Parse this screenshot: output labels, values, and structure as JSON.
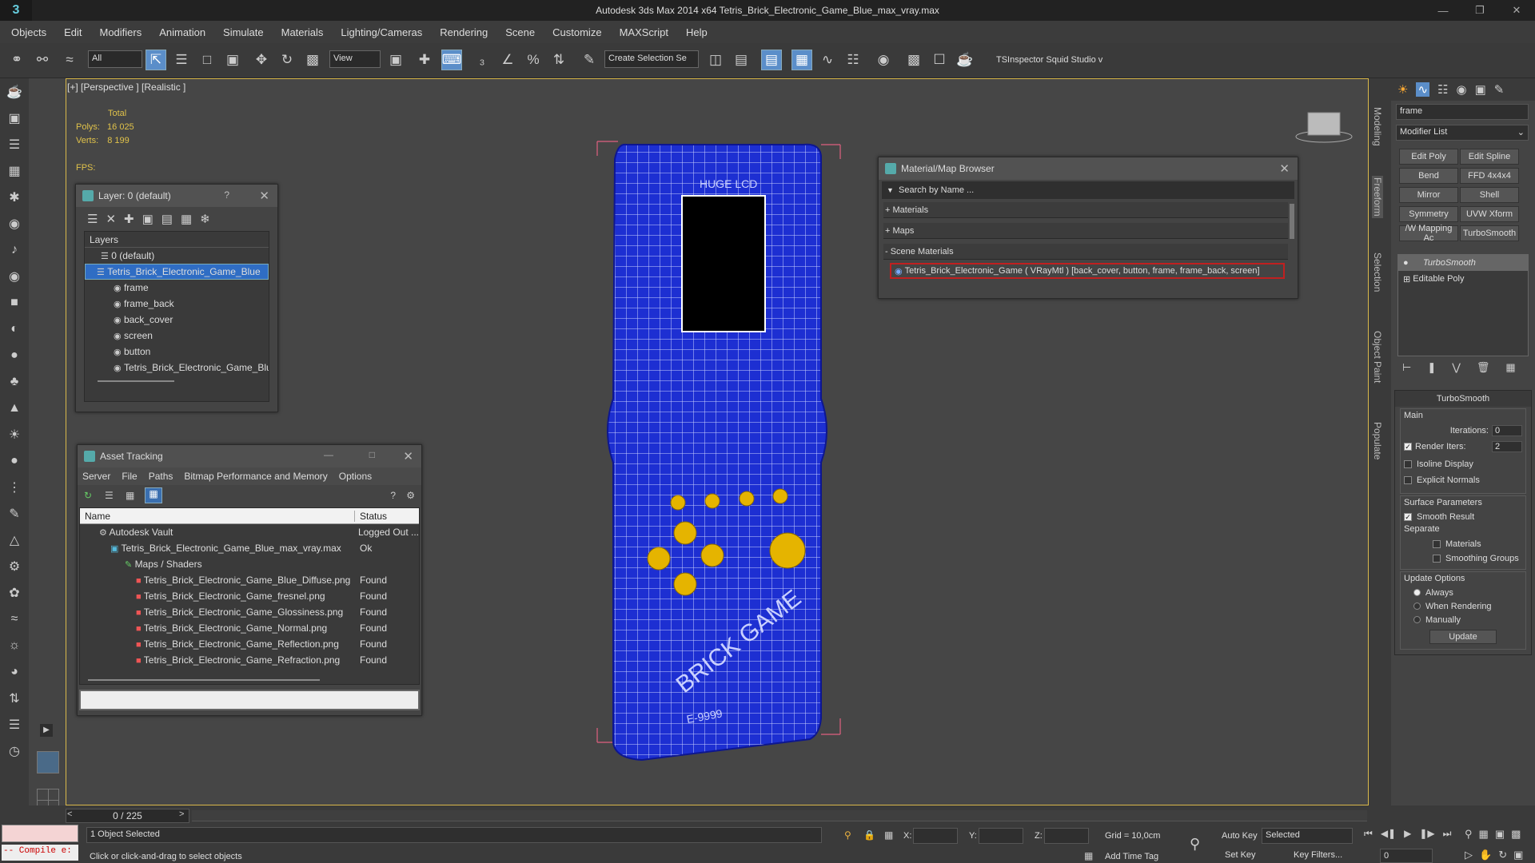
{
  "app": {
    "title": "Autodesk 3ds Max  2014 x64     Tetris_Brick_Electronic_Game_Blue_max_vray.max",
    "menus": [
      "Objects",
      "Edit",
      "Modifiers",
      "Animation",
      "Simulate",
      "Materials",
      "Lighting/Cameras",
      "Rendering",
      "Scene",
      "Customize",
      "MAXScript",
      "Help"
    ]
  },
  "toolbar": {
    "filter": "All",
    "refcoord": "View",
    "selection_set": "Create Selection Se",
    "plugins": "TSInspector  Squid Studio v"
  },
  "viewport": {
    "label": "[+] [Perspective ] [Realistic ]",
    "stats_total": "Total",
    "polys_label": "Polys:",
    "polys": "16 025",
    "verts_label": "Verts:",
    "verts": "8 199",
    "fps_label": "FPS:"
  },
  "layer_window": {
    "title": "Layer: 0 (default)",
    "help": "?",
    "column": "Layers",
    "items": [
      "0 (default)",
      "Tetris_Brick_Electronic_Game_Blue",
      "frame",
      "frame_back",
      "back_cover",
      "screen",
      "button",
      "Tetris_Brick_Electronic_Game_Blue"
    ]
  },
  "asset_tracking": {
    "title": "Asset Tracking",
    "menus": [
      "Server",
      "File",
      "Paths",
      "Bitmap Performance and Memory",
      "Options"
    ],
    "col_name": "Name",
    "col_status": "Status",
    "rows": [
      {
        "name": "Autodesk Vault",
        "status": "Logged Out ..."
      },
      {
        "name": "Tetris_Brick_Electronic_Game_Blue_max_vray.max",
        "status": "Ok"
      },
      {
        "name": "Maps / Shaders",
        "status": ""
      },
      {
        "name": "Tetris_Brick_Electronic_Game_Blue_Diffuse.png",
        "status": "Found"
      },
      {
        "name": "Tetris_Brick_Electronic_Game_fresnel.png",
        "status": "Found"
      },
      {
        "name": "Tetris_Brick_Electronic_Game_Glossiness.png",
        "status": "Found"
      },
      {
        "name": "Tetris_Brick_Electronic_Game_Normal.png",
        "status": "Found"
      },
      {
        "name": "Tetris_Brick_Electronic_Game_Reflection.png",
        "status": "Found"
      },
      {
        "name": "Tetris_Brick_Electronic_Game_Refraction.png",
        "status": "Found"
      }
    ]
  },
  "material_browser": {
    "title": "Material/Map Browser",
    "search_placeholder": "Search by Name ...",
    "sections": [
      "+ Materials",
      "+ Maps",
      "- Scene Materials"
    ],
    "scene_material": "Tetris_Brick_Electronic_Game  ( VRayMtl )  [back_cover, button, frame, frame_back, screen]"
  },
  "command_panel": {
    "object_name": "frame",
    "modifier_list": "Modifier List",
    "buttons": [
      "Edit Poly",
      "Edit Spline",
      "Bend",
      "FFD 4x4x4",
      "Mirror",
      "Shell",
      "Symmetry",
      "UVW Xform",
      "/W Mapping Ac",
      "TurboSmooth"
    ],
    "stack": [
      "TurboSmooth",
      "Editable Poly"
    ],
    "rollout_title": "TurboSmooth",
    "main_label": "Main",
    "iterations_label": "Iterations:",
    "iterations": "0",
    "render_iters_label": "Render Iters:",
    "render_iters": "2",
    "isoline": "Isoline Display",
    "explicit_normals": "Explicit Normals",
    "surface_params": "Surface Parameters",
    "smooth_result": "Smooth Result",
    "separate": "Separate",
    "materials": "Materials",
    "smoothing_groups": "Smoothing Groups",
    "update_options": "Update Options",
    "always": "Always",
    "when_rendering": "When Rendering",
    "manually": "Manually",
    "update_btn": "Update"
  },
  "right_tabs": [
    "Modeling",
    "Freeform",
    "Selection",
    "Object Paint",
    "Populate"
  ],
  "status": {
    "time": "0 / 225",
    "prev": "<",
    "next": ">",
    "maxscript": "-- Compile e:",
    "selected": "1 Object Selected",
    "prompt": "Click or click-and-drag to select objects",
    "x_label": "X:",
    "y_label": "Y:",
    "z_label": "Z:",
    "grid": "Grid = 10,0cm",
    "add_time_tag": "Add Time Tag",
    "auto_key": "Auto Key",
    "set_key": "Set Key",
    "key_mode": "Selected",
    "key_filters": "Key Filters...",
    "frame": "0"
  },
  "model": {
    "logo_top": "BRICK GAME",
    "model_num": "E-9999",
    "lcd": "HUGE LCD"
  }
}
